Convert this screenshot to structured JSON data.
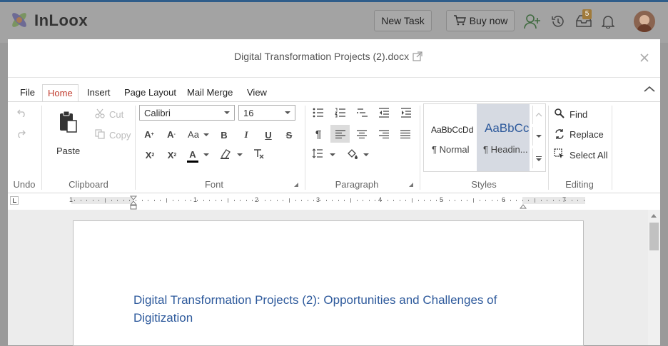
{
  "app": {
    "brand": "InLoox",
    "new_task": "New Task",
    "buy_now": "Buy now",
    "notif_count": "5"
  },
  "dialog": {
    "title": "Digital Transformation Projects (2).docx"
  },
  "ribbon": {
    "tabs": [
      "File",
      "Home",
      "Insert",
      "Page Layout",
      "Mail Merge",
      "View"
    ],
    "active_tab": "Home",
    "groups": {
      "undo": "Undo",
      "clipboard": "Clipboard",
      "font": "Font",
      "paragraph": "Paragraph",
      "styles": "Styles",
      "editing": "Editing"
    },
    "clipboard": {
      "paste": "Paste",
      "cut": "Cut",
      "copy": "Copy"
    },
    "font": {
      "family": "Calibri",
      "size": "16"
    },
    "styles": [
      {
        "preview": "AaBbCcDd",
        "name": "¶ Normal"
      },
      {
        "preview": "AaBbCc",
        "name": "¶ Headin..."
      }
    ],
    "editing": {
      "find": "Find",
      "replace": "Replace",
      "select_all": "Select All"
    }
  },
  "ruler": {
    "numbers": [
      "1",
      "1",
      "2",
      "3",
      "4",
      "5",
      "6",
      "7"
    ]
  },
  "document": {
    "heading": "Digital Transformation Projects (2): Opportunities and Challenges of Digitization"
  },
  "colors": {
    "accent": "#c0392b",
    "heading": "#2e5a9c",
    "brand_blue": "#2f5d8a"
  }
}
